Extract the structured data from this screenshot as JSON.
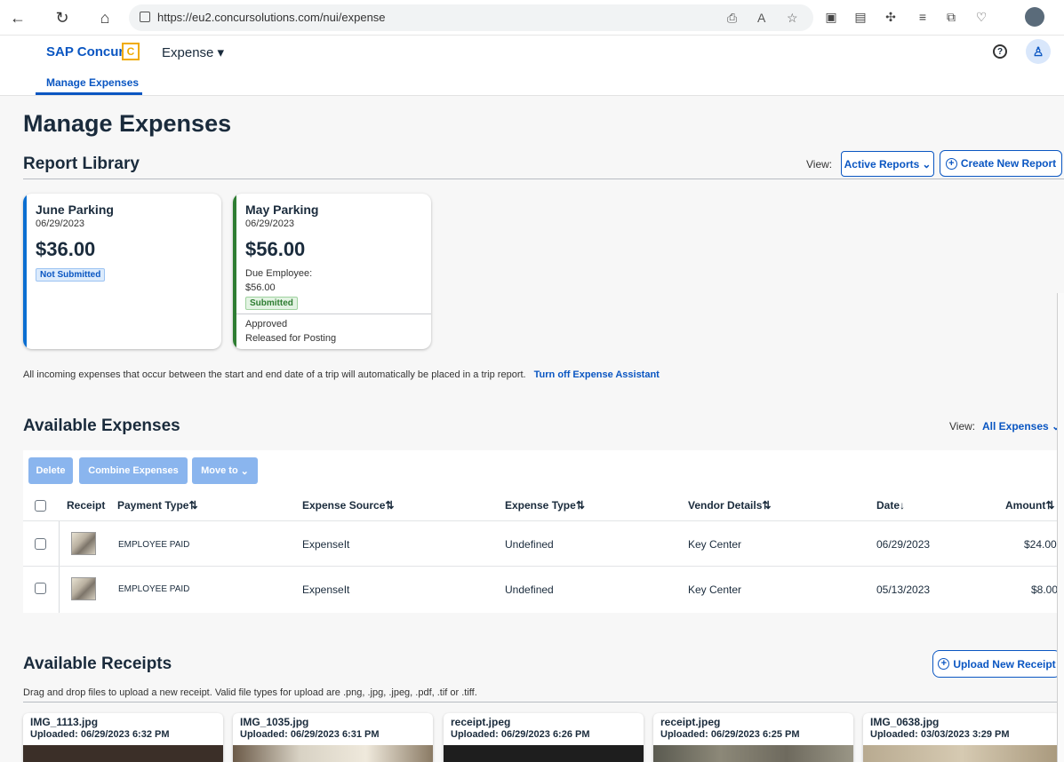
{
  "browser": {
    "url": "https://eu2.concursolutions.com/nui/expense"
  },
  "header": {
    "brand": "SAP Concur",
    "brand_mark": "C",
    "expense_menu": "Expense ▾",
    "subtab": "Manage Expenses"
  },
  "page": {
    "title": "Manage Expenses"
  },
  "report_library": {
    "title": "Report Library",
    "view_label": "View:",
    "view_value": "Active Reports",
    "create_button": "Create New Report",
    "cards": [
      {
        "name": "June Parking",
        "date": "06/29/2023",
        "amount": "$36.00",
        "status": "Not Submitted",
        "accent": "#0a6ed1"
      },
      {
        "name": "May Parking",
        "date": "06/29/2023",
        "amount": "$56.00",
        "due_label": "Due Employee:",
        "due_amount": "$56.00",
        "status": "Submitted",
        "approval": "Approved",
        "posting": "Released for Posting",
        "accent": "#2e7d32"
      }
    ]
  },
  "assistant": {
    "text": "All incoming expenses that occur between the start and end date of a trip will automatically be placed in a trip report.",
    "link": "Turn off Expense Assistant"
  },
  "available_expenses": {
    "title": "Available Expenses",
    "view_label": "View:",
    "view_value": "All Expenses",
    "actions": [
      "Delete",
      "Combine Expenses",
      "Move to"
    ],
    "columns": [
      "Receipt",
      "Payment Type",
      "Expense Source",
      "Expense Type",
      "Vendor Details",
      "Date",
      "Amount"
    ],
    "rows": [
      {
        "payment_type": "EMPLOYEE PAID",
        "source": "ExpenseIt",
        "type": "Undefined",
        "vendor": "Key Center",
        "date": "06/29/2023",
        "amount": "$24.00"
      },
      {
        "payment_type": "EMPLOYEE PAID",
        "source": "ExpenseIt",
        "type": "Undefined",
        "vendor": "Key Center",
        "date": "05/13/2023",
        "amount": "$8.00"
      }
    ]
  },
  "available_receipts": {
    "title": "Available Receipts",
    "upload_button": "Upload New Receipt",
    "drag_text": "Drag and drop files to upload a new receipt. Valid file types for upload are .png, .jpg, .jpeg, .pdf, .tif or .tiff.",
    "receipts": [
      {
        "name": "IMG_1113.jpg",
        "uploaded": "Uploaded: 06/29/2023 6:32 PM"
      },
      {
        "name": "IMG_1035.jpg",
        "uploaded": "Uploaded: 06/29/2023 6:31 PM"
      },
      {
        "name": "receipt.jpeg",
        "uploaded": "Uploaded: 06/29/2023 6:26 PM"
      },
      {
        "name": "receipt.jpeg",
        "uploaded": "Uploaded: 06/29/2023 6:25 PM"
      },
      {
        "name": "IMG_0638.jpg",
        "uploaded": "Uploaded: 03/03/2023 3:29 PM"
      }
    ]
  },
  "colors": {
    "accent": "#0a56c2",
    "not_submitted_bg": "#dcebfc",
    "submitted_bg": "#e3f3e3",
    "disabled_button": "#8ab5ee"
  }
}
